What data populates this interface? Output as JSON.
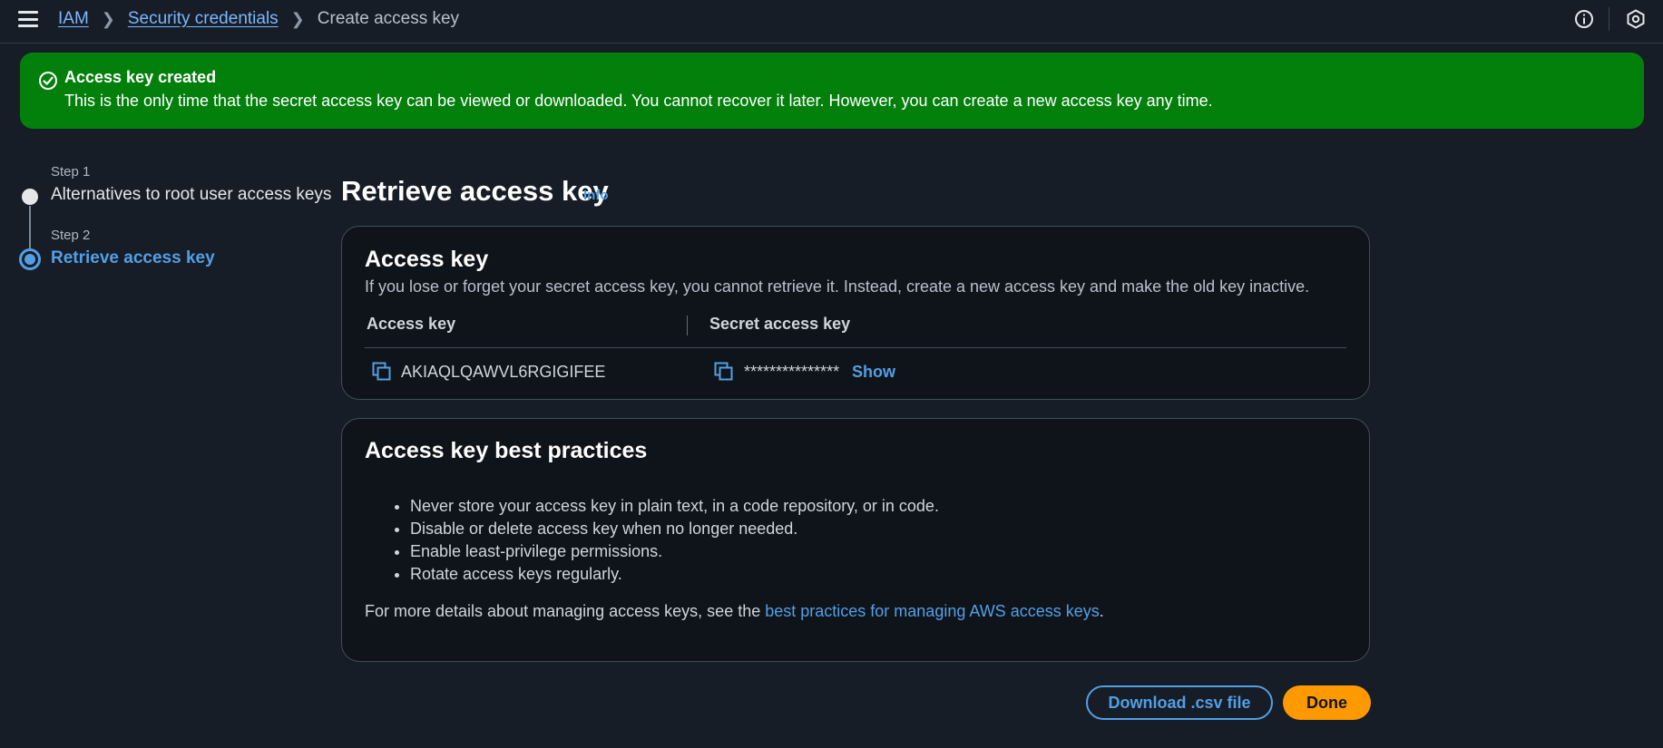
{
  "breadcrumb": {
    "items": [
      "IAM",
      "Security credentials"
    ],
    "current": "Create access key"
  },
  "flash": {
    "title": "Access key created",
    "message": "This is the only time that the secret access key can be viewed or downloaded. You cannot recover it later. However, you can create a new access key any time."
  },
  "steps": [
    {
      "label": "Step 1",
      "title": "Alternatives to root user access keys"
    },
    {
      "label": "Step 2",
      "title": "Retrieve access key"
    }
  ],
  "page": {
    "title": "Retrieve access key",
    "info_link": "Info"
  },
  "access_key_card": {
    "title": "Access key",
    "description": "If you lose or forget your secret access key, you cannot retrieve it. Instead, create a new access key and make the old key inactive.",
    "columns": [
      "Access key",
      "Secret access key"
    ],
    "access_key_value": "AKIAQLQAWVL6RGIGIFEE",
    "secret_masked": "***************",
    "show_label": "Show"
  },
  "best_practices_card": {
    "title": "Access key best practices",
    "items": [
      "Never store your access key in plain text, in a code repository, or in code.",
      "Disable or delete access key when no longer needed.",
      "Enable least-privilege permissions.",
      "Rotate access keys regularly."
    ],
    "footer_prefix": "For more details about managing access keys, see the ",
    "footer_link": "best practices for managing AWS access keys",
    "footer_suffix": "."
  },
  "buttons": {
    "download": "Download .csv file",
    "done": "Done"
  },
  "icons": {
    "menu": "hamburger-menu-icon",
    "info": "info-circle-icon",
    "settings": "settings-icon",
    "success": "check-circle-icon",
    "copy": "copy-icon"
  },
  "colors": {
    "background": "#161d26",
    "success": "#037f0c",
    "link": "#539fe5",
    "primary_button": "#ff9900"
  }
}
